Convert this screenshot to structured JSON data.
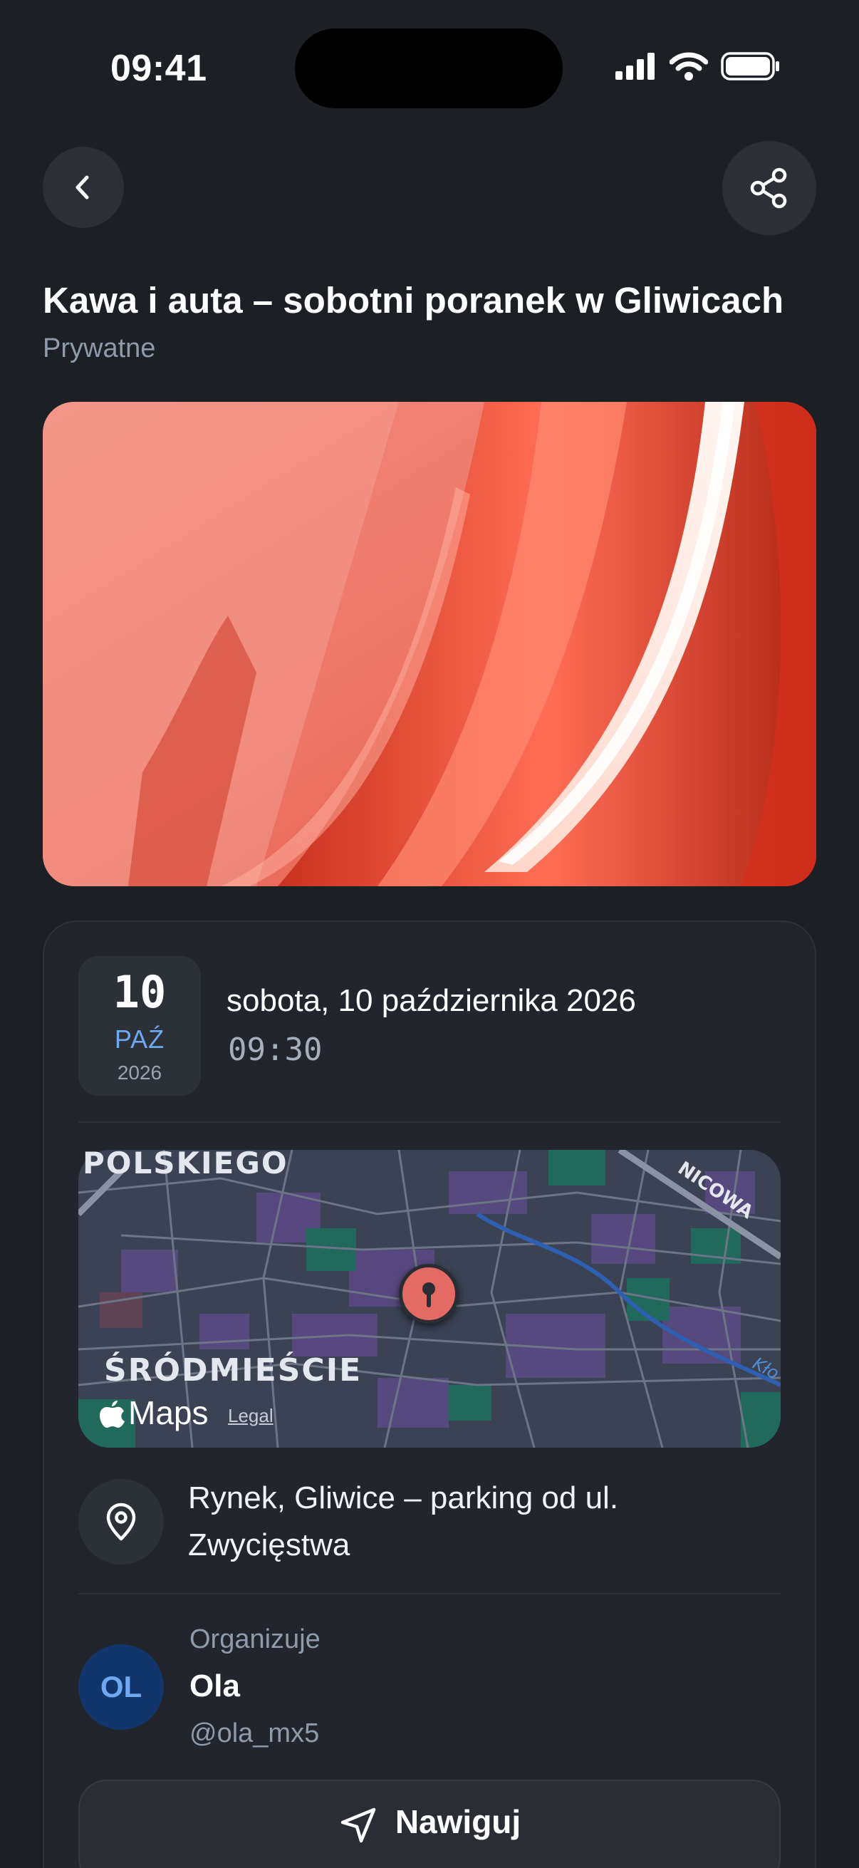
{
  "status_bar": {
    "time": "09:41"
  },
  "header": {
    "back_icon": "chevron-left-icon",
    "share_icon": "share-icon"
  },
  "event": {
    "title": "Kawa i auta – sobotni poranek w Gliwicach",
    "visibility": "Prywatne"
  },
  "date_badge": {
    "day": "10",
    "month": "PAŹ",
    "year": "2026"
  },
  "datetime": {
    "full_date": "sobota, 10 października 2026",
    "time": "09:30"
  },
  "map": {
    "label_top": "POLSKIEGO",
    "label_district": "ŚRÓDMIEŚCIE",
    "label_street": "NICOWA",
    "label_river": "Kło",
    "provider": "Maps",
    "legal": "Legal"
  },
  "location": {
    "icon": "location-pin-icon",
    "address": "Rynek, Gliwice – parking od ul. Zwycięstwa"
  },
  "organizer": {
    "label": "Organizuje",
    "initials": "OL",
    "name": "Ola",
    "handle": "@ola_mx5"
  },
  "actions": {
    "navigate_label": "Nawiguj",
    "navigate_icon": "navigation-arrow-icon"
  },
  "colors": {
    "background": "#1c1f24",
    "accent": "#6ea8f0",
    "card": "#22262c",
    "pin": "#e46a64"
  }
}
